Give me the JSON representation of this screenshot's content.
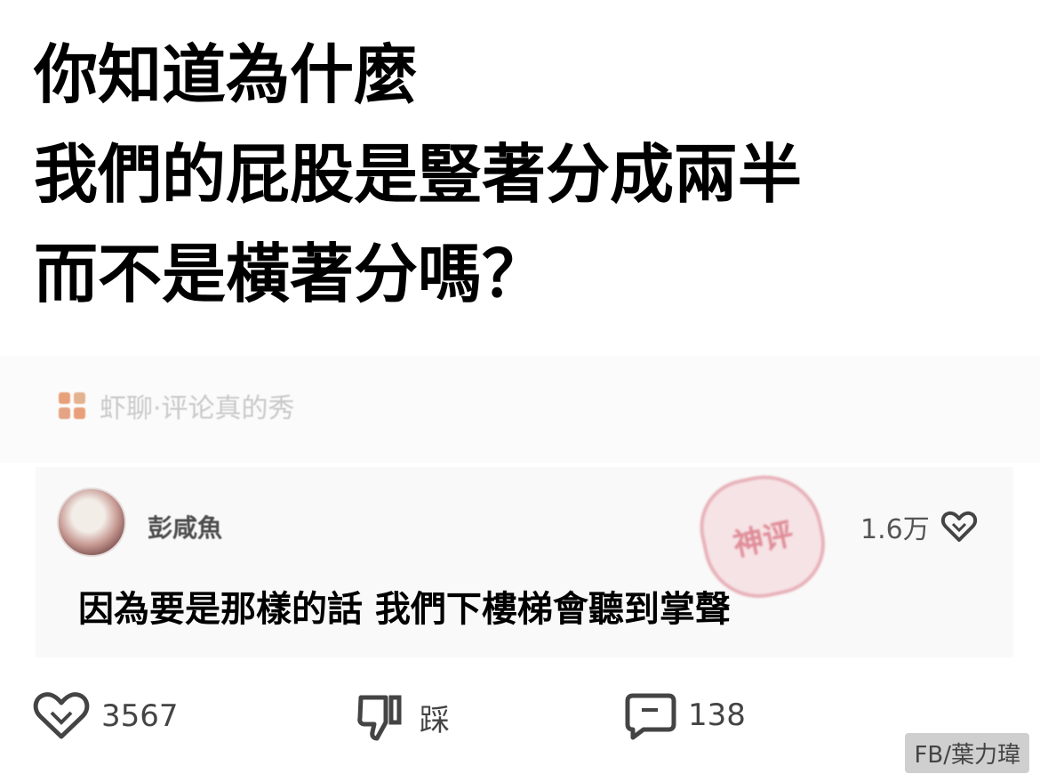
{
  "question": {
    "line1": "你知道為什麼",
    "line2": "我們的屁股是豎著分成兩半",
    "line3": "而不是橫著分嗎？"
  },
  "source": {
    "label": "虾聊·评论真的秀"
  },
  "comment": {
    "username": "彭咸魚",
    "stamp_text": "神评",
    "like_count": "1.6万",
    "text": "因為要是那樣的話 我們下樓梯會聽到掌聲"
  },
  "actions": {
    "like_count": "3567",
    "dislike_label": "踩",
    "reply_count": "138"
  },
  "watermark": "FB/葉力瑋",
  "colors": {
    "background": "#ffffff",
    "card": "#f9f9f9",
    "stamp": "#d87882",
    "icon": "#444444"
  }
}
